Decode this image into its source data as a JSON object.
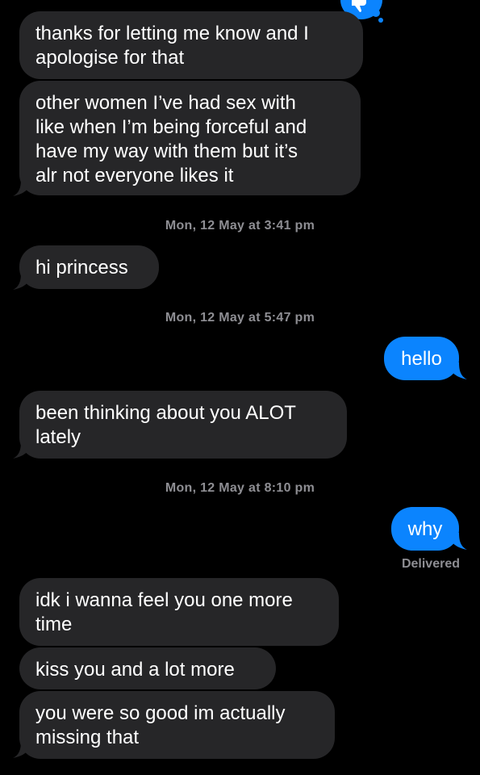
{
  "conversation": {
    "messages": [
      {
        "direction": "incoming",
        "text": "thanks for letting me know and I\napologise for that"
      },
      {
        "direction": "incoming",
        "text": "other women I’ve had sex with\nlike when I’m being forceful and\nhave my way with them but it’s\nalr not everyone likes it"
      },
      {
        "direction": "incoming",
        "text": "hi princess"
      },
      {
        "direction": "outgoing",
        "text": "hello"
      },
      {
        "direction": "incoming",
        "text": "been thinking about you ALOT\nlately"
      },
      {
        "direction": "outgoing",
        "text": "why"
      },
      {
        "direction": "incoming",
        "text": "idk i wanna feel you one more\ntime"
      },
      {
        "direction": "incoming",
        "text": "kiss you and a lot more"
      },
      {
        "direction": "incoming",
        "text": "you were so good im actually\nmissing that"
      }
    ],
    "timestamps": [
      "Mon, 12 May at 3:41 pm",
      "Mon, 12 May at 5:47 pm",
      "Mon, 12 May at 8:10 pm"
    ],
    "delivery_status": "Delivered",
    "reaction_icon": "thumbs-down-tapback-icon"
  },
  "colors": {
    "background": "#000000",
    "incoming_bubble": "#262628",
    "outgoing_bubble": "#0b84fe",
    "meta_text": "#8e8e93"
  }
}
